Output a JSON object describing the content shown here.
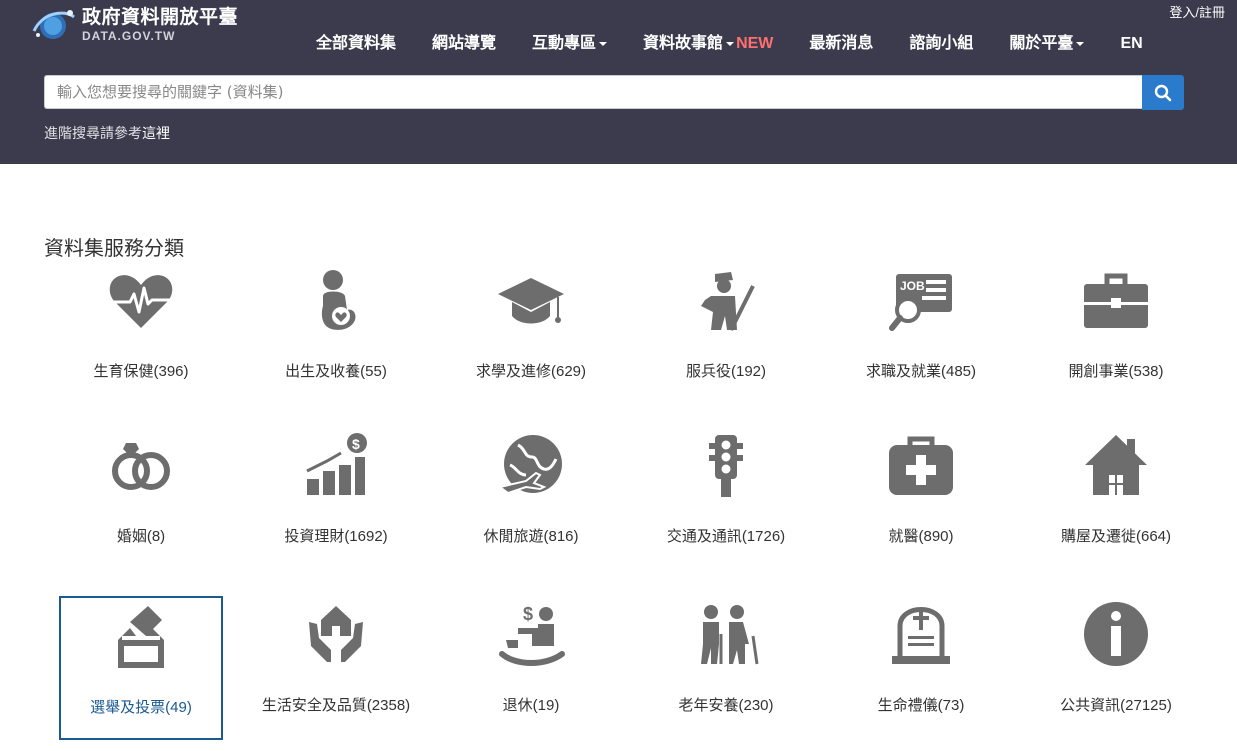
{
  "header": {
    "logo_cn": "政府資料開放平臺",
    "logo_en": "DATA.GOV.TW",
    "login": "登入/註冊",
    "nav": [
      {
        "label": "全部資料集",
        "dropdown": false
      },
      {
        "label": "網站導覽",
        "dropdown": false
      },
      {
        "label": "互動專區",
        "dropdown": true
      },
      {
        "label": "資料故事館",
        "dropdown": true,
        "badge": "NEW"
      },
      {
        "label": "最新消息",
        "dropdown": false
      },
      {
        "label": "諮詢小組",
        "dropdown": false
      },
      {
        "label": "關於平臺",
        "dropdown": true
      },
      {
        "label": "EN",
        "dropdown": false
      }
    ],
    "search_placeholder": "輸入您想要搜尋的關鍵字 (資料集)",
    "adv_prefix": "進階搜尋請參考",
    "adv_link": "這裡"
  },
  "section_title": "資料集服務分類",
  "colors": {
    "header_bg": "#3b3b4d",
    "search_button": "#2b7bcd",
    "icon_gray": "#6d6d6d",
    "active_border": "#1a5a93",
    "new_badge": "#ff6f6f"
  },
  "categories": [
    {
      "label": "生育保健(396)",
      "icon": "heart-pulse-icon"
    },
    {
      "label": "出生及收養(55)",
      "icon": "mother-baby-icon"
    },
    {
      "label": "求學及進修(629)",
      "icon": "graduation-cap-icon"
    },
    {
      "label": "服兵役(192)",
      "icon": "soldier-icon"
    },
    {
      "label": "求職及就業(485)",
      "icon": "job-search-icon"
    },
    {
      "label": "開創事業(538)",
      "icon": "briefcase-icon"
    },
    {
      "label": "婚姻(8)",
      "icon": "rings-icon"
    },
    {
      "label": "投資理財(1692)",
      "icon": "growth-chart-icon"
    },
    {
      "label": "休閒旅遊(816)",
      "icon": "globe-plane-icon"
    },
    {
      "label": "交通及通訊(1726)",
      "icon": "traffic-light-icon"
    },
    {
      "label": "就醫(890)",
      "icon": "medical-kit-icon"
    },
    {
      "label": "購屋及遷徙(664)",
      "icon": "house-icon"
    },
    {
      "label": "選舉及投票(49)",
      "icon": "ballot-box-icon",
      "active": true
    },
    {
      "label": "生活安全及品質(2358)",
      "icon": "hands-house-icon"
    },
    {
      "label": "退休(19)",
      "icon": "rocking-chair-icon"
    },
    {
      "label": "老年安養(230)",
      "icon": "elderly-couple-icon"
    },
    {
      "label": "生命禮儀(73)",
      "icon": "tombstone-icon"
    },
    {
      "label": "公共資訊(27125)",
      "icon": "info-circle-icon"
    }
  ]
}
